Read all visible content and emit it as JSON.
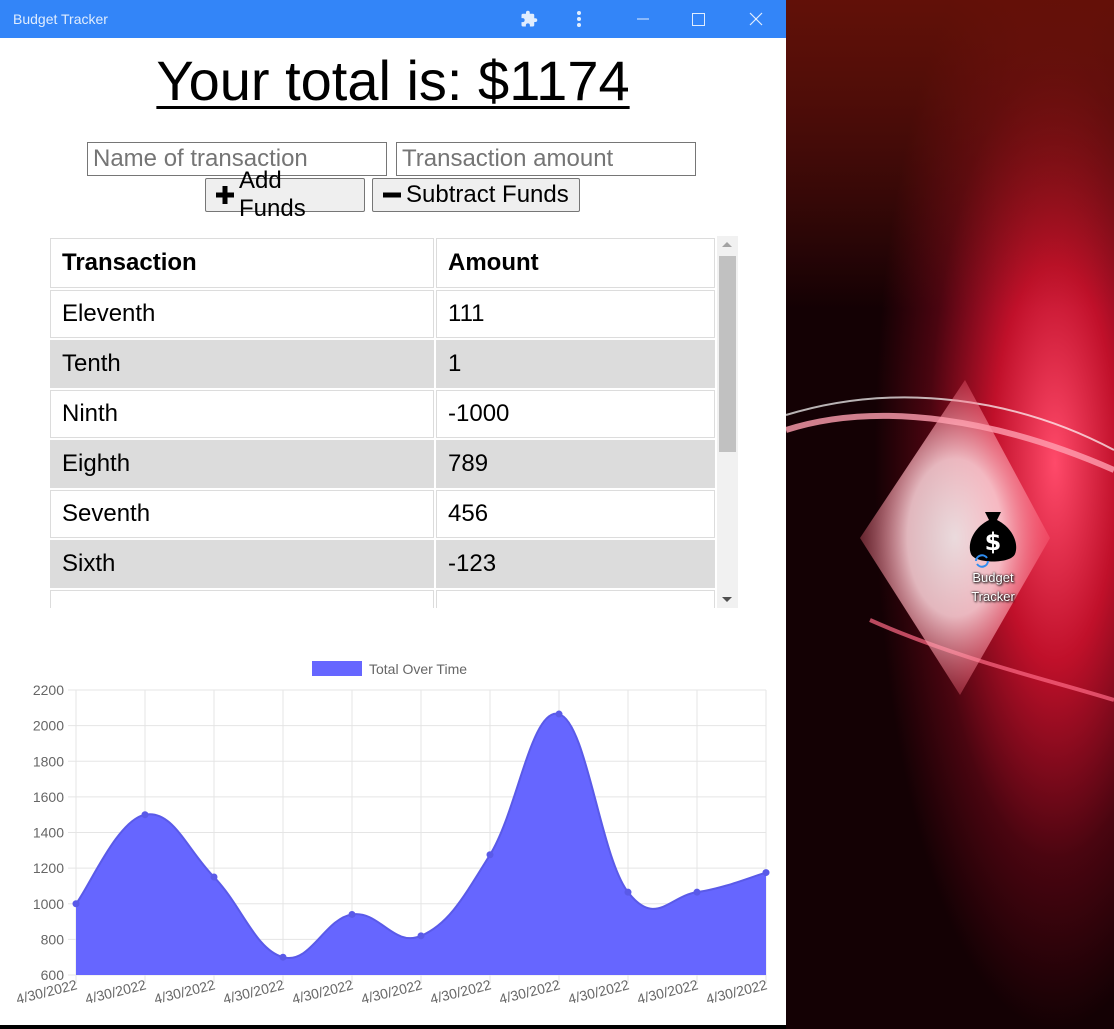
{
  "window": {
    "title": "Budget Tracker",
    "accent": "#3385f8"
  },
  "header": {
    "total_text": "Your total is: $1174"
  },
  "form": {
    "name_placeholder": "Name of transaction",
    "amount_placeholder": "Transaction amount",
    "add_label": "Add Funds",
    "subtract_label": "Subtract Funds"
  },
  "table": {
    "headers": [
      "Transaction",
      "Amount"
    ],
    "rows": [
      {
        "name": "Eleventh",
        "amount": "111"
      },
      {
        "name": "Tenth",
        "amount": "1"
      },
      {
        "name": "Ninth",
        "amount": "-1000"
      },
      {
        "name": "Eighth",
        "amount": "789"
      },
      {
        "name": "Seventh",
        "amount": "456"
      },
      {
        "name": "Sixth",
        "amount": "-123"
      },
      {
        "name": "",
        "amount": ""
      }
    ]
  },
  "desktop": {
    "icon_label_line1": "Budget",
    "icon_label_line2": "Tracker"
  },
  "chart_data": {
    "type": "area",
    "legend": "Total Over Time",
    "legend_position": "top",
    "fill_color": "#6666ff",
    "x": [
      "4/30/2022",
      "4/30/2022",
      "4/30/2022",
      "4/30/2022",
      "4/30/2022",
      "4/30/2022",
      "4/30/2022",
      "4/30/2022",
      "4/30/2022",
      "4/30/2022",
      "4/30/2022"
    ],
    "values": [
      1000,
      1500,
      1150,
      700,
      940,
      820,
      1275,
      2065,
      1065,
      1065,
      1175
    ],
    "ylim": [
      600,
      2200
    ],
    "yticks": [
      600,
      800,
      1000,
      1200,
      1400,
      1600,
      1800,
      2000,
      2200
    ],
    "grid": true
  }
}
